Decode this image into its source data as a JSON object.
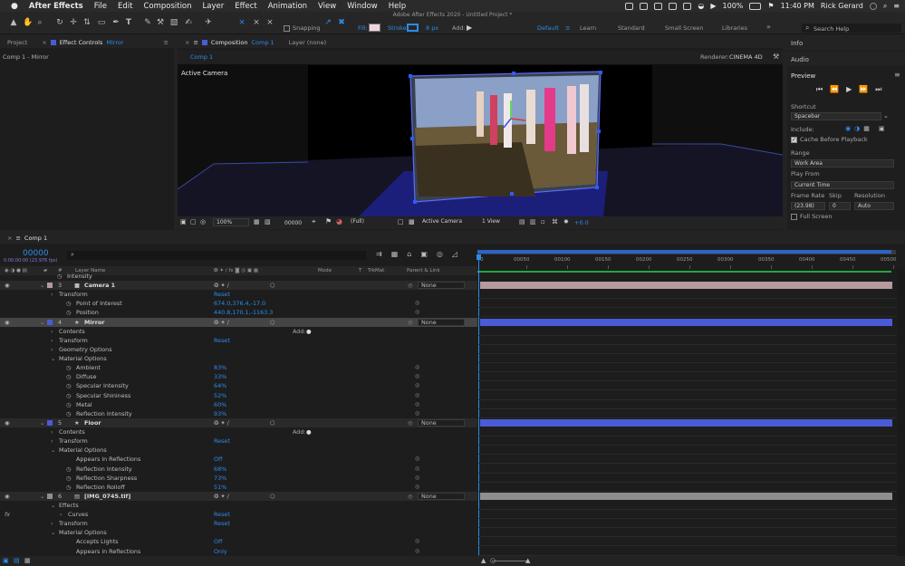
{
  "menubar": {
    "apple": "",
    "app_name": "After Effects",
    "items": [
      "File",
      "Edit",
      "Composition",
      "Layer",
      "Effect",
      "Animation",
      "View",
      "Window",
      "Help"
    ],
    "battery": "100%",
    "time": "11:40 PM",
    "user": "Rick Gerard"
  },
  "window_title": "Adobe After Effects 2020 - Untitled Project *",
  "toolbar": {
    "snapping_label": "Snapping",
    "fill_label": "Fill:",
    "stroke_label": "Stroke:",
    "stroke_width": "8 px",
    "add_label": "Add:",
    "workspaces": [
      "Default",
      "Learn",
      "Standard",
      "Small Screen",
      "Libraries"
    ],
    "search_placeholder": "Search Help"
  },
  "left_panel": {
    "tab_project": "Project",
    "tab_effect_controls": "Effect Controls",
    "effect_controls_target": "Mirror",
    "header": "Comp 1 - Mirror"
  },
  "comp_panel": {
    "tab_label": "Composition",
    "tab_comp": "Comp 1",
    "layer_tab": "Layer (none)",
    "sub_tab": "Comp 1",
    "renderer_label": "Renderer:",
    "renderer_value": "CINEMA 4D",
    "viewer_label": "Active Camera",
    "zoom": "100%",
    "timecode": "00000",
    "resolution": "(Full)",
    "camera": "Active Camera",
    "views": "1 View",
    "exposure": "+0.0"
  },
  "right_panel": {
    "info": "Info",
    "audio": "Audio",
    "preview": "Preview",
    "shortcut_label": "Shortcut",
    "shortcut_value": "Spacebar",
    "include_label": "Include:",
    "cache_label": "Cache Before Playback",
    "range_label": "Range",
    "range_value": "Work Area",
    "play_from_label": "Play From",
    "play_from_value": "Current Time",
    "frame_rate_label": "Frame Rate",
    "skip_label": "Skip",
    "resolution_label": "Resolution",
    "frame_rate_value": "(23.98)",
    "skip_value": "0",
    "resolution_value": "Auto",
    "full_screen_label": "Full Screen"
  },
  "timeline": {
    "tab": "Comp 1",
    "timecode": "00000",
    "timecode_sub": "0:00:00:00 (23.976 fps)",
    "search_placeholder": "",
    "columns": {
      "num": "#",
      "layer_name": "Layer Name",
      "mode": "Mode",
      "t": "T",
      "trkmat": "TrkMat",
      "parent": "Parent & Link"
    },
    "ruler": [
      "00050",
      "00100",
      "00150",
      "00200",
      "00250",
      "00300",
      "00350",
      "00400",
      "00450",
      "00500"
    ],
    "ruler_start": "0",
    "rows": [
      {
        "type": "prop",
        "indent": 1,
        "name": "Intensity",
        "value": "",
        "partial": true
      },
      {
        "type": "layer",
        "num": "3",
        "icon": "camera-icon",
        "name": "Camera 1",
        "parent": "None",
        "color": "#b59aa0"
      },
      {
        "type": "group",
        "indent": 1,
        "name": "Transform",
        "value": "Reset"
      },
      {
        "type": "prop",
        "indent": 2,
        "name": "Point of Interest",
        "value": "674.0,376.4,-17.0"
      },
      {
        "type": "prop",
        "indent": 2,
        "name": "Position",
        "value": "440.8,170.1,-1163.3"
      },
      {
        "type": "layer",
        "num": "4",
        "icon": "star-icon",
        "name": "Mirror",
        "parent": "None",
        "color": "#4a5bd8",
        "selected": true
      },
      {
        "type": "group",
        "indent": 1,
        "name": "Contents",
        "value": "",
        "add": "Add:"
      },
      {
        "type": "group",
        "indent": 1,
        "name": "Transform",
        "value": "Reset"
      },
      {
        "type": "group",
        "indent": 1,
        "name": "Geometry Options",
        "value": ""
      },
      {
        "type": "group",
        "indent": 1,
        "name": "Material Options",
        "value": "",
        "open": true
      },
      {
        "type": "prop",
        "indent": 2,
        "name": "Ambient",
        "value": "83%"
      },
      {
        "type": "prop",
        "indent": 2,
        "name": "Diffuse",
        "value": "33%"
      },
      {
        "type": "prop",
        "indent": 2,
        "name": "Specular Intensity",
        "value": "64%"
      },
      {
        "type": "prop",
        "indent": 2,
        "name": "Specular Shininess",
        "value": "52%"
      },
      {
        "type": "prop",
        "indent": 2,
        "name": "Metal",
        "value": "60%"
      },
      {
        "type": "prop",
        "indent": 2,
        "name": "Reflection Intensity",
        "value": "93%"
      },
      {
        "type": "layer",
        "num": "5",
        "icon": "star-icon",
        "name": "Floor",
        "parent": "None",
        "color": "#4a5bd8"
      },
      {
        "type": "group",
        "indent": 1,
        "name": "Contents",
        "value": "",
        "add": "Add:"
      },
      {
        "type": "group",
        "indent": 1,
        "name": "Transform",
        "value": "Reset"
      },
      {
        "type": "group",
        "indent": 1,
        "name": "Material Options",
        "value": "",
        "open": true
      },
      {
        "type": "prop",
        "indent": 2,
        "name": "Appears in Reflections",
        "value": "Off",
        "nostop": true
      },
      {
        "type": "prop",
        "indent": 2,
        "name": "Reflection Intensity",
        "value": "68%"
      },
      {
        "type": "prop",
        "indent": 2,
        "name": "Reflection Sharpness",
        "value": "73%"
      },
      {
        "type": "prop",
        "indent": 2,
        "name": "Reflection Rolloff",
        "value": "51%"
      },
      {
        "type": "layer",
        "num": "6",
        "icon": "file-icon",
        "name": "[IMG_0745.tif]",
        "parent": "None",
        "color": "#8f8f8f"
      },
      {
        "type": "group",
        "indent": 1,
        "name": "Effects",
        "value": "",
        "open": true
      },
      {
        "type": "group",
        "indent": 2,
        "name": "Curves",
        "value": "Reset",
        "fx": true
      },
      {
        "type": "group",
        "indent": 1,
        "name": "Transform",
        "value": "Reset"
      },
      {
        "type": "group",
        "indent": 1,
        "name": "Material Options",
        "value": "",
        "open": true
      },
      {
        "type": "prop",
        "indent": 2,
        "name": "Accepts Lights",
        "value": "Off",
        "nostop": true
      },
      {
        "type": "prop",
        "indent": 2,
        "name": "Appears in Reflections",
        "value": "Only",
        "nostop": true
      }
    ]
  },
  "colors": {
    "accent": "#2d8ceb",
    "label_blue": "#4a5bd8",
    "camera_track": "#b59aa0",
    "image_track": "#8f8f8f"
  }
}
